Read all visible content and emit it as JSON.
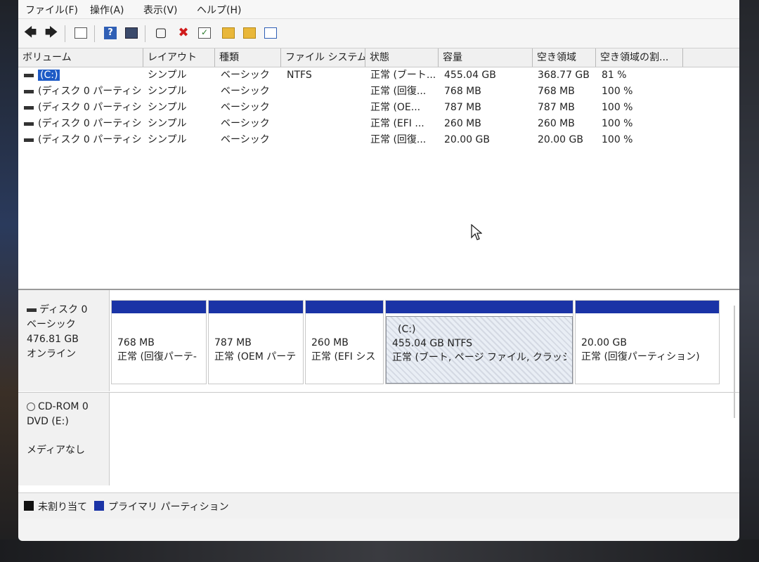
{
  "menu": [
    "ファイル(F)",
    "操作(A)",
    "表示(V)",
    "ヘルプ(H)"
  ],
  "table": {
    "headers": [
      "ボリューム",
      "レイアウト",
      "種類",
      "ファイル システム",
      "状態",
      "容量",
      "空き領域",
      "空き領域の割..."
    ],
    "rows": [
      {
        "volume": "(C:)",
        "layout": "シンプル",
        "type": "ベーシック",
        "fs": "NTFS",
        "status": "正常 (ブート...",
        "capacity": "455.04 GB",
        "free": "368.77 GB",
        "pct": "81 %"
      },
      {
        "volume": "(ディスク 0 パーティシ...",
        "layout": "シンプル",
        "type": "ベーシック",
        "fs": "",
        "status": "正常 (回復...",
        "capacity": "768 MB",
        "free": "768 MB",
        "pct": "100 %"
      },
      {
        "volume": "(ディスク 0 パーティシ...",
        "layout": "シンプル",
        "type": "ベーシック",
        "fs": "",
        "status": "正常 (OE...",
        "capacity": "787 MB",
        "free": "787 MB",
        "pct": "100 %"
      },
      {
        "volume": "(ディスク 0 パーティシ...",
        "layout": "シンプル",
        "type": "ベーシック",
        "fs": "",
        "status": "正常 (EFI ...",
        "capacity": "260 MB",
        "free": "260 MB",
        "pct": "100 %"
      },
      {
        "volume": "(ディスク 0 パーティシ...",
        "layout": "シンプル",
        "type": "ベーシック",
        "fs": "",
        "status": "正常 (回復...",
        "capacity": "20.00 GB",
        "free": "20.00 GB",
        "pct": "100 %"
      }
    ]
  },
  "disk0": {
    "name": "ディスク 0",
    "type": "ベーシック",
    "size": "476.81 GB",
    "state": "オンライン",
    "partitions": [
      {
        "title": "",
        "size": "768 MB",
        "status": "正常 (回復パーテ-"
      },
      {
        "title": "",
        "size": "787 MB",
        "status": "正常 (OEM パーテ"
      },
      {
        "title": "",
        "size": "260 MB",
        "status": "正常 (EFI シス"
      },
      {
        "title": "(C:)",
        "size": "455.04 GB NTFS",
        "status": "正常 (ブート, ページ ファイル, クラッシュ・"
      },
      {
        "title": "",
        "size": "20.00 GB",
        "status": "正常 (回復パーティション)"
      }
    ]
  },
  "cdrom": {
    "name": "CD-ROM 0",
    "drive": "DVD (E:)",
    "media": "メディアなし"
  },
  "legend": {
    "unallocated": "未割り当て",
    "primary": "プライマリ パーティション",
    "unallocated_color": "#111111",
    "primary_color": "#1a33a6"
  }
}
